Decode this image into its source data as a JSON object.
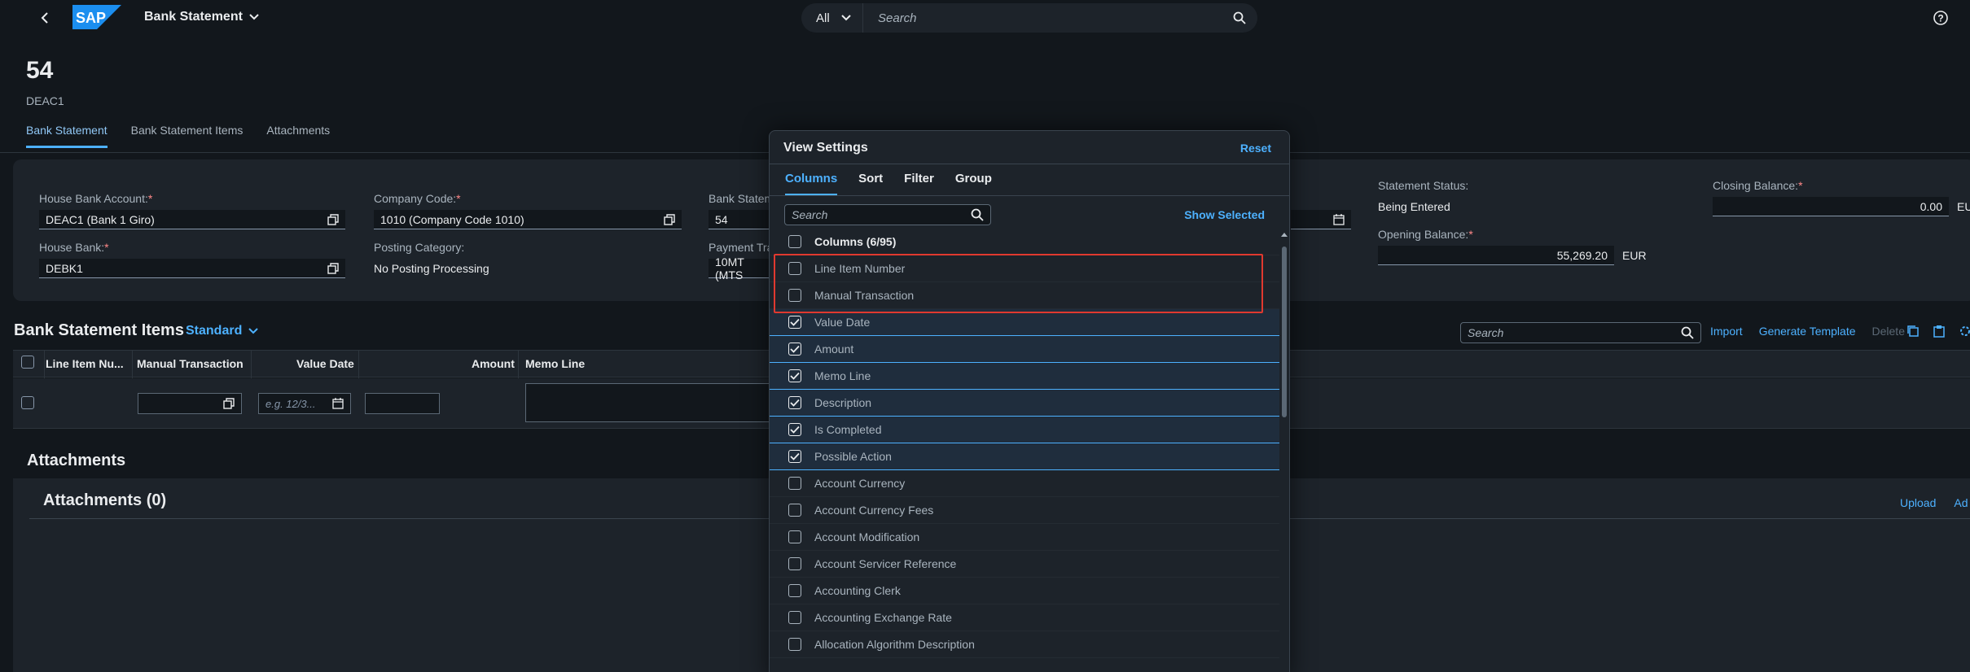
{
  "shell": {
    "app_title": "Bank Statement",
    "search_scope": "All",
    "search_placeholder": "Search"
  },
  "header": {
    "title": "54",
    "subtitle": "DEAC1",
    "tabs": [
      "Bank Statement",
      "Bank Statement Items",
      "Attachments"
    ]
  },
  "form": {
    "house_bank_account_label": "House Bank Account:",
    "house_bank_account_value": "DEAC1 (Bank 1 Giro)",
    "company_code_label": "Company Code:",
    "company_code_value": "1010 (Company Code 1010)",
    "bank_statement_label": "Bank Statem",
    "bank_statement_value": "54",
    "house_bank_label": "House Bank:",
    "house_bank_value": "DEBK1",
    "posting_category_label": "Posting Category:",
    "posting_category_value": "No Posting Processing",
    "payment_tr_label": "Payment Tra",
    "payment_tr_value": "10MT (MTS",
    "statement_status_label": "Statement Status:",
    "statement_status_value": "Being Entered",
    "opening_balance_label": "Opening Balance:",
    "opening_balance_value": "55,269.20",
    "opening_balance_currency": "EUR",
    "closing_balance_label": "Closing Balance:",
    "closing_balance_value": "0.00",
    "closing_balance_currency": "EU",
    "required_mark": "*"
  },
  "items": {
    "title": "Bank Statement Items",
    "variant": "Standard",
    "search_placeholder": "Search",
    "actions": [
      "Import",
      "Generate Template",
      "Delete"
    ],
    "columns": [
      "Line Item Nu...",
      "Manual Transaction",
      "Value Date",
      "Amount",
      "Memo Line"
    ],
    "date_placeholder": "e.g. 12/3..."
  },
  "attachments": {
    "heading": "Attachments",
    "title": "Attachments (0)",
    "upload": "Upload",
    "add": "Ad"
  },
  "dialog": {
    "title": "View Settings",
    "reset": "Reset",
    "tabs": [
      "Columns",
      "Sort",
      "Filter",
      "Group"
    ],
    "search_placeholder": "Search",
    "show_selected": "Show Selected",
    "header_row": "Columns (6/95)",
    "rows": [
      {
        "label": "Line Item Number",
        "checked": false
      },
      {
        "label": "Manual Transaction",
        "checked": false
      },
      {
        "label": "Value Date",
        "checked": true
      },
      {
        "label": "Amount",
        "checked": true
      },
      {
        "label": "Memo Line",
        "checked": true
      },
      {
        "label": "Description",
        "checked": true
      },
      {
        "label": "Is Completed",
        "checked": true
      },
      {
        "label": "Possible Action",
        "checked": true
      },
      {
        "label": "Account Currency",
        "checked": false
      },
      {
        "label": "Account Currency Fees",
        "checked": false
      },
      {
        "label": "Account Modification",
        "checked": false
      },
      {
        "label": "Account Servicer Reference",
        "checked": false
      },
      {
        "label": "Accounting Clerk",
        "checked": false
      },
      {
        "label": "Accounting Exchange Rate",
        "checked": false
      },
      {
        "label": "Allocation Algorithm Description",
        "checked": false
      }
    ]
  },
  "colors": {
    "background": "#12171c",
    "surface": "#1d232a",
    "accent": "#4db1ff",
    "highlight_box": "#e0392f"
  }
}
